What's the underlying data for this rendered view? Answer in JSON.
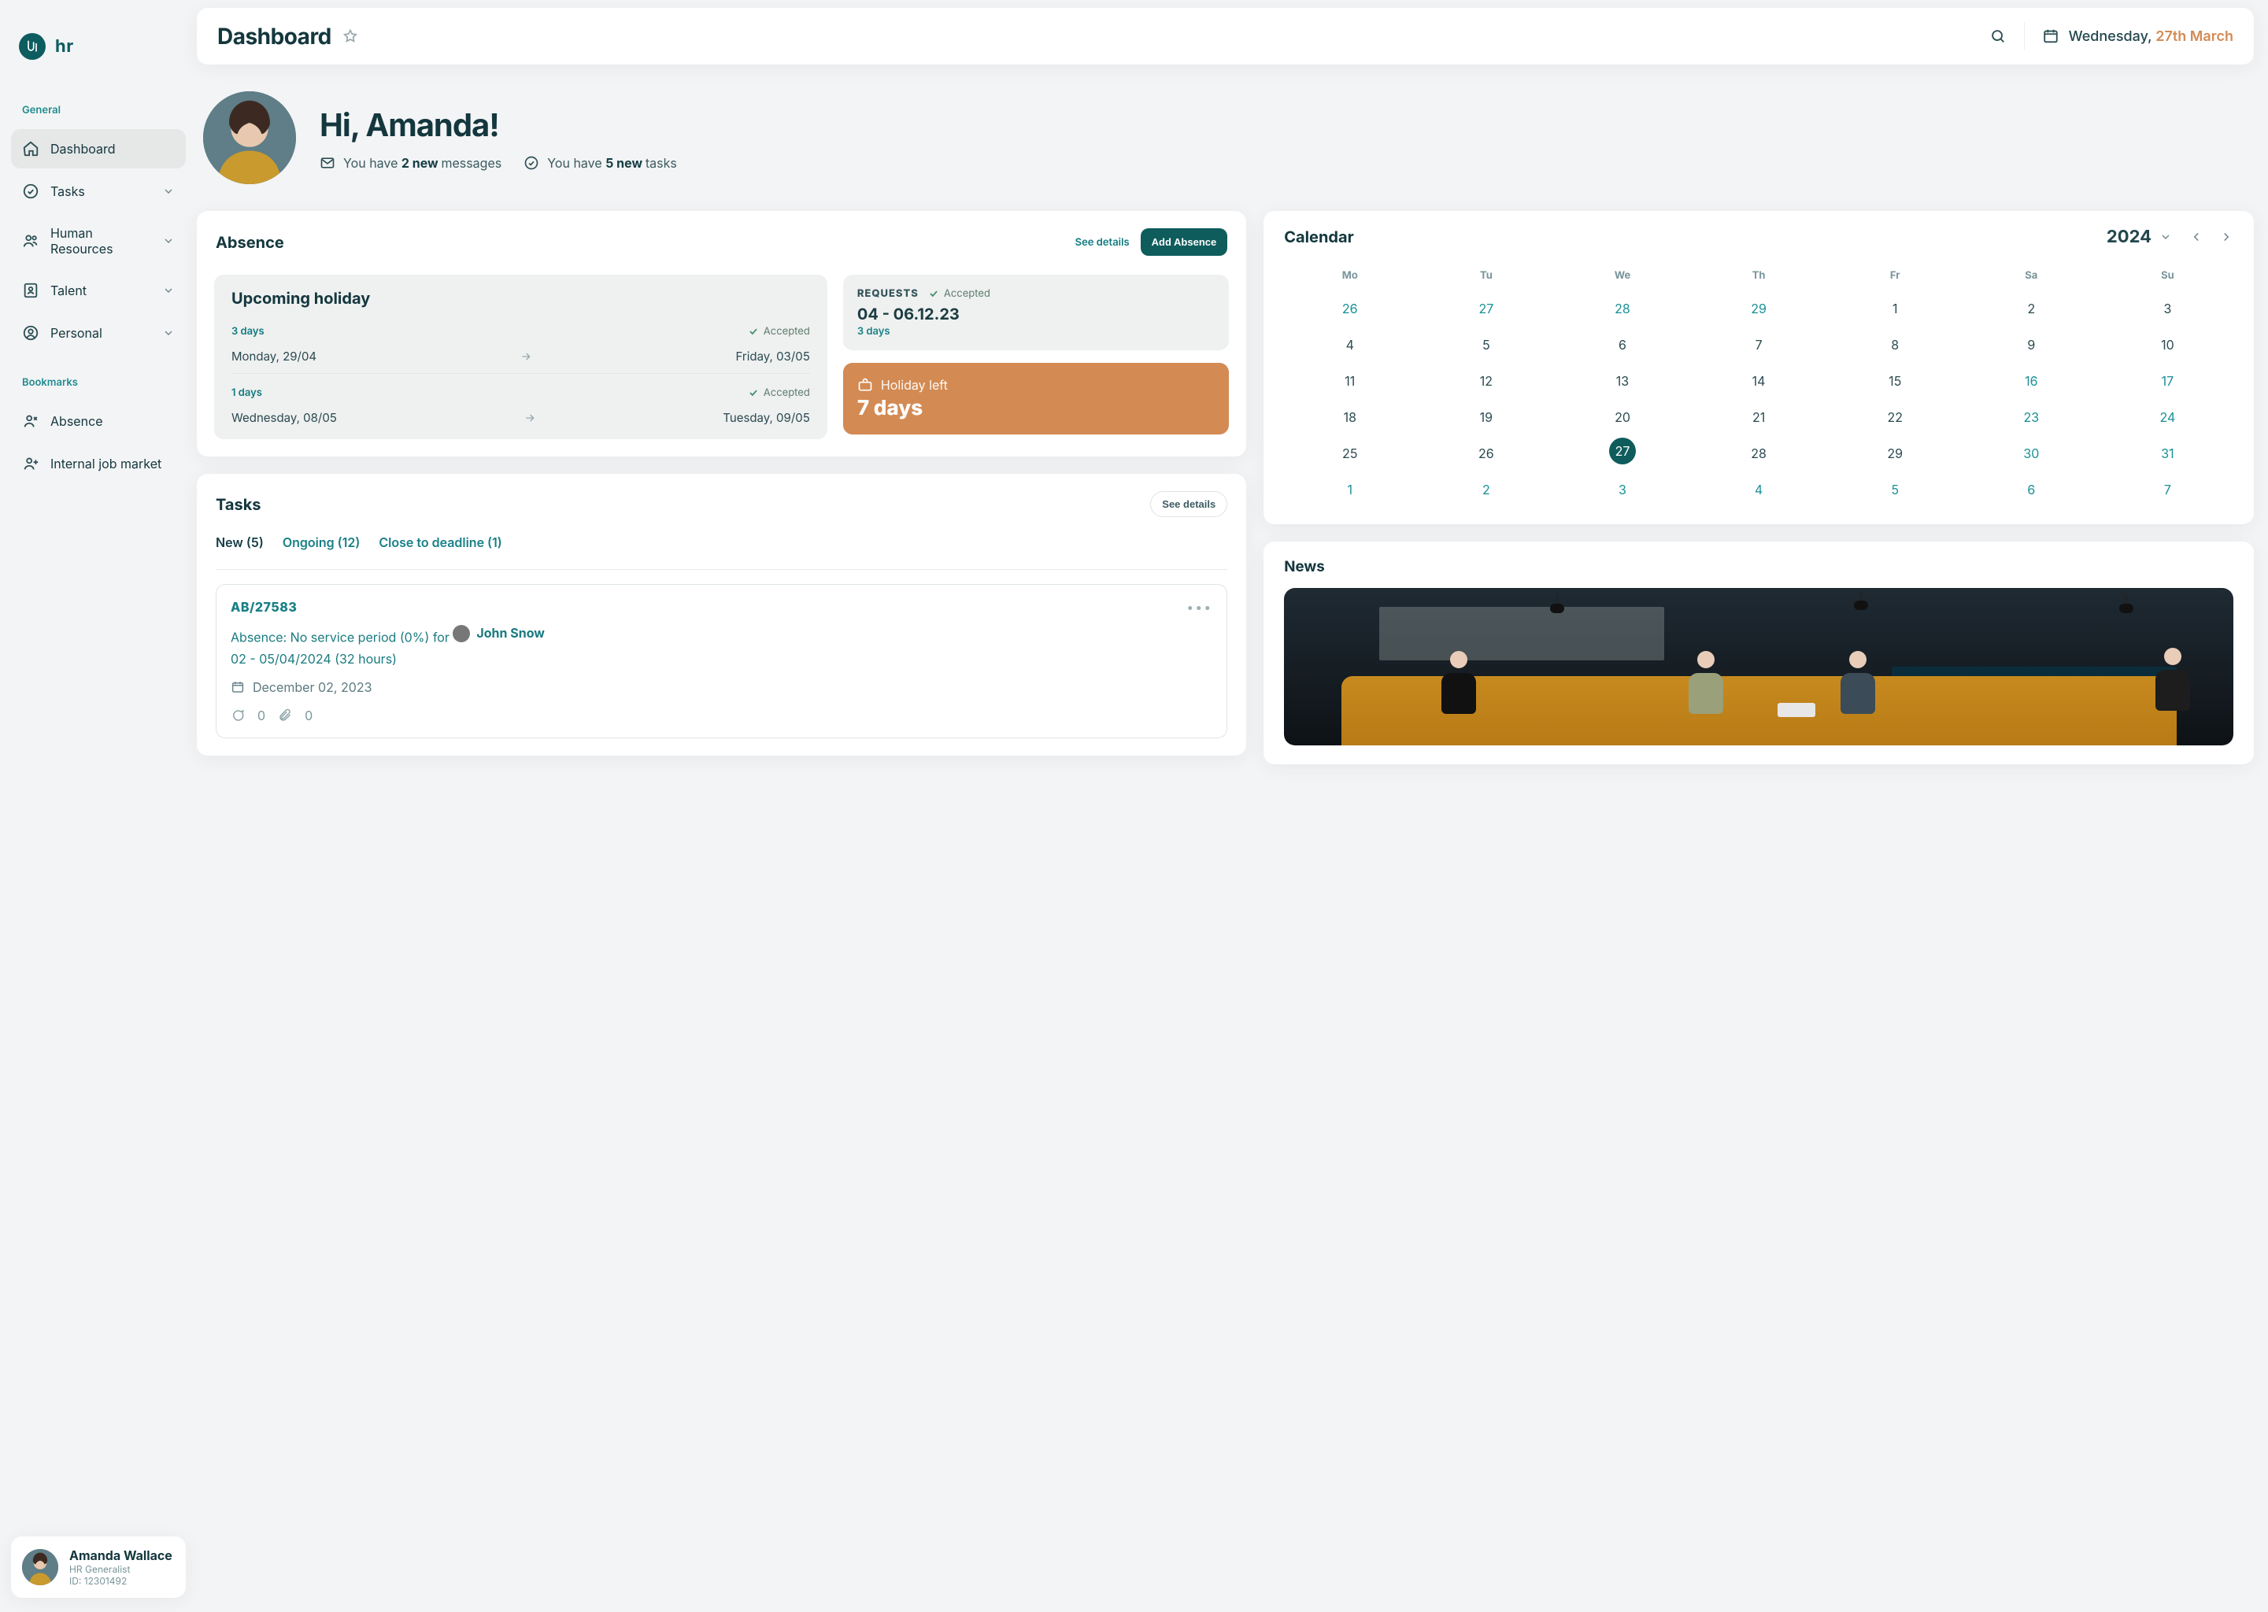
{
  "brand": {
    "text": "hr"
  },
  "sidebar": {
    "generalLabel": "General",
    "bookmarksLabel": "Bookmarks",
    "items": [
      {
        "label": "Dashboard"
      },
      {
        "label": "Tasks"
      },
      {
        "label": "Human Resources"
      },
      {
        "label": "Talent"
      },
      {
        "label": "Personal"
      }
    ],
    "bookmarks": [
      {
        "label": "Absence"
      },
      {
        "label": "Internal job market"
      }
    ]
  },
  "user": {
    "name": "Amanda Wallace",
    "role": "HR Generalist",
    "id": "ID: 12301492"
  },
  "topbar": {
    "title": "Dashboard",
    "date_weekday": "Wednesday, ",
    "date_day": "27th March"
  },
  "greeting": {
    "hello": "Hi, Amanda!",
    "msgs_pre": "You have ",
    "msgs_bold": "2 new ",
    "msgs_post": "messages",
    "tasks_pre": "You have ",
    "tasks_bold": "5 new ",
    "tasks_post": "tasks"
  },
  "absence": {
    "title": "Absence",
    "see": "See details",
    "add": "Add Absence",
    "upcoming": "Upcoming holiday",
    "h1_days": "3 days",
    "acceptedLabel": "Accepted",
    "h1_from": "Monday, 29/04",
    "h1_to": "Friday, 03/05",
    "h2_days": "1 days",
    "h2_from": "Wednesday, 08/05",
    "h2_to": "Tuesday, 09/05",
    "reqTitle": "REQUESTS",
    "reqRange": "04 - 06.12.23",
    "reqSub": "3 days",
    "left_title": "Holiday left",
    "left_val": "7 days"
  },
  "tasks": {
    "title": "Tasks",
    "see": "See details",
    "tabs": [
      {
        "label": "New (5)"
      },
      {
        "label": "Ongoing (12)"
      },
      {
        "label": "Close to deadline (1)"
      }
    ],
    "card": {
      "id": "AB/27583",
      "title_pre": "Absence: No service period (0%) for ",
      "name": "John Snow",
      "line2": "02 - 05/04/2024 (32 hours)",
      "metaDate": "December 02, 2023",
      "comments": "0",
      "attachments": "0"
    }
  },
  "calendar": {
    "title": "Calendar",
    "year": "2024",
    "dows": [
      "Mo",
      "Tu",
      "We",
      "Th",
      "Fr",
      "Sa",
      "Su"
    ],
    "days": [
      {
        "n": "26",
        "muted": true
      },
      {
        "n": "27",
        "muted": true
      },
      {
        "n": "28",
        "muted": true
      },
      {
        "n": "29",
        "muted": true
      },
      {
        "n": "1"
      },
      {
        "n": "2"
      },
      {
        "n": "3"
      },
      {
        "n": "4"
      },
      {
        "n": "5"
      },
      {
        "n": "6"
      },
      {
        "n": "7"
      },
      {
        "n": "8"
      },
      {
        "n": "9"
      },
      {
        "n": "10"
      },
      {
        "n": "11"
      },
      {
        "n": "12"
      },
      {
        "n": "13"
      },
      {
        "n": "14"
      },
      {
        "n": "15"
      },
      {
        "n": "16",
        "muted": true
      },
      {
        "n": "17",
        "muted": true
      },
      {
        "n": "18"
      },
      {
        "n": "19"
      },
      {
        "n": "20"
      },
      {
        "n": "21"
      },
      {
        "n": "22"
      },
      {
        "n": "23",
        "muted": true
      },
      {
        "n": "24",
        "muted": true
      },
      {
        "n": "25"
      },
      {
        "n": "26"
      },
      {
        "n": "27",
        "today": true
      },
      {
        "n": "28"
      },
      {
        "n": "29"
      },
      {
        "n": "30",
        "muted": true
      },
      {
        "n": "31",
        "muted": true
      },
      {
        "n": "1",
        "muted": true
      },
      {
        "n": "2",
        "muted": true
      },
      {
        "n": "3",
        "muted": true
      },
      {
        "n": "4",
        "muted": true
      },
      {
        "n": "5",
        "muted": true
      },
      {
        "n": "6",
        "muted": true
      },
      {
        "n": "7",
        "muted": true
      }
    ]
  },
  "news": {
    "title": "News"
  }
}
